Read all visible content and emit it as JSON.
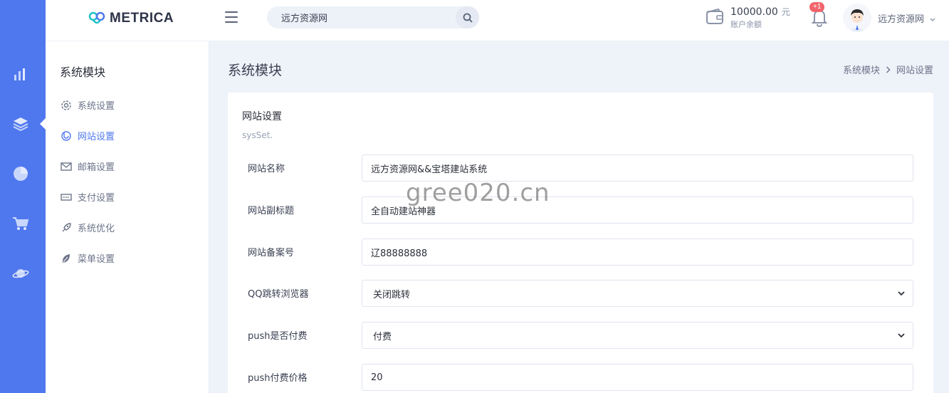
{
  "brand": {
    "name": "METRICA",
    "accent": "#4f77ee"
  },
  "rail": {
    "icons": [
      "bar-chart-icon",
      "layers-icon",
      "pie-chart-icon",
      "cart-icon",
      "planet-icon"
    ]
  },
  "search": {
    "value": "远方资源网"
  },
  "wallet": {
    "amount": "10000.00",
    "unit": "元",
    "label": "账户余额"
  },
  "notifications": {
    "badge": "+1"
  },
  "user": {
    "name": "远方资源网"
  },
  "sidebar": {
    "title": "系统模块",
    "items": [
      {
        "label": "系统设置",
        "icon": "gear-icon"
      },
      {
        "label": "网站设置",
        "icon": "website-icon",
        "active": true
      },
      {
        "label": "邮箱设置",
        "icon": "mail-icon"
      },
      {
        "label": "支付设置",
        "icon": "card-icon"
      },
      {
        "label": "系统优化",
        "icon": "rocket-icon"
      },
      {
        "label": "菜单设置",
        "icon": "leaf-icon"
      }
    ]
  },
  "page": {
    "title": "系统模块",
    "breadcrumb": [
      "系统模块",
      "网站设置"
    ]
  },
  "card": {
    "title": "网站设置",
    "subtitle": "sysSet."
  },
  "form": {
    "site_name": {
      "label": "网站名称",
      "value": "远方资源网&&宝塔建站系统"
    },
    "site_subtitle": {
      "label": "网站副标题",
      "value": "全自动建站神器"
    },
    "icp": {
      "label": "网站备案号",
      "value": "辽88888888"
    },
    "qq_redirect": {
      "label": "QQ跳转浏览器",
      "value": "关闭跳转"
    },
    "push_paid": {
      "label": "push是否付费",
      "value": "付费"
    },
    "push_price": {
      "label": "push付费价格",
      "value": "20"
    }
  },
  "watermark": "gree020.cn"
}
